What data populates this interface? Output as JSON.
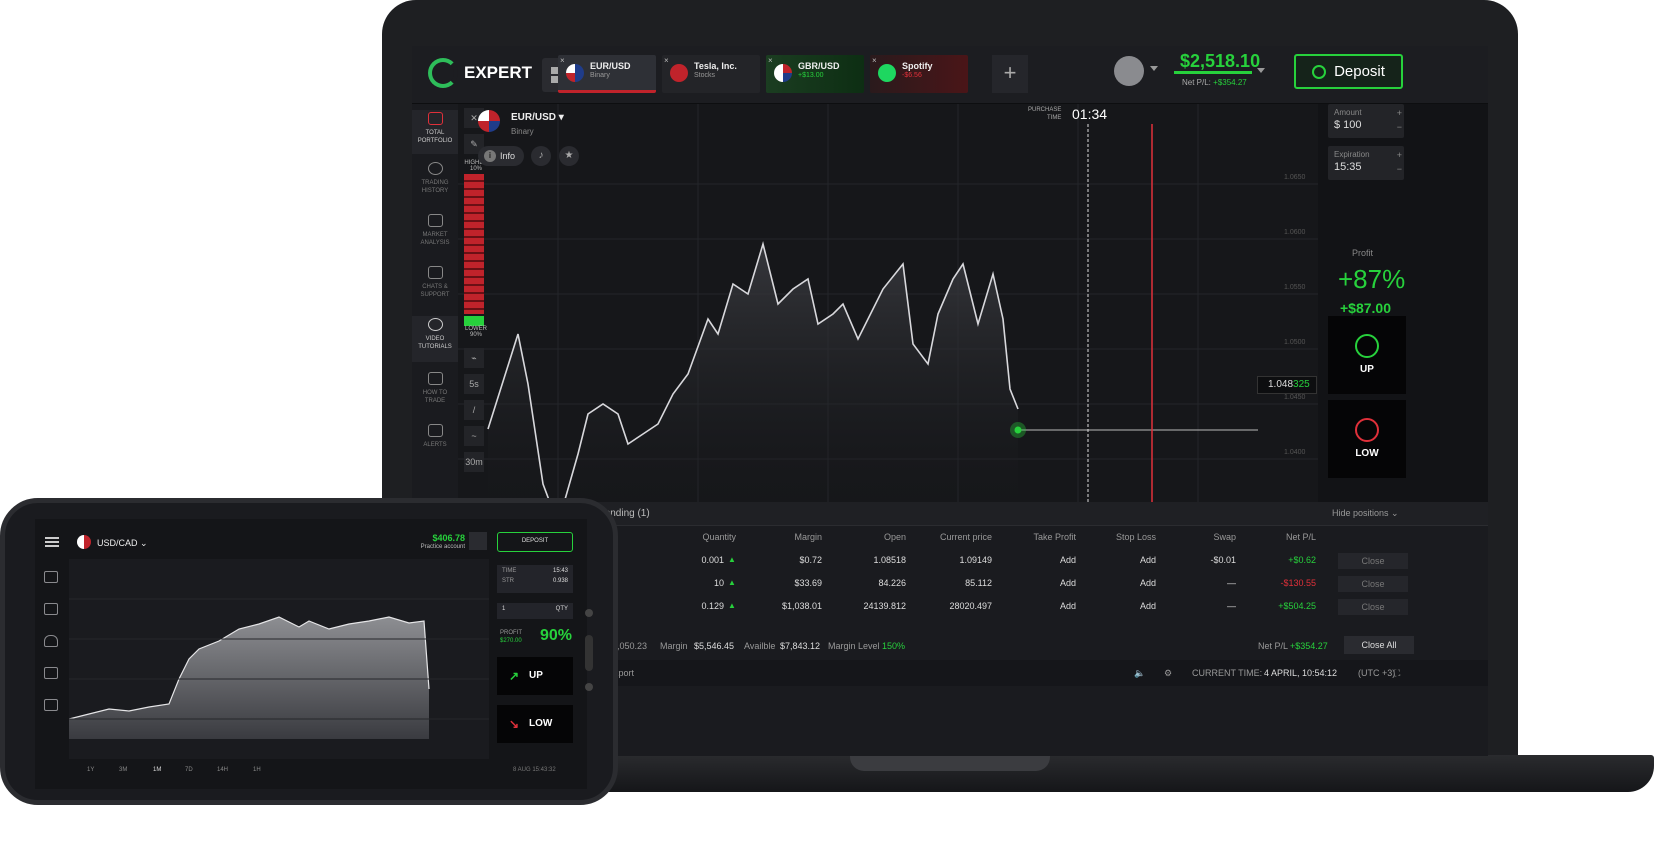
{
  "app": {
    "brand": "EXPERT"
  },
  "tabs": [
    {
      "name": "EUR/USD",
      "sub": "Binary",
      "sub_tone": "neutral"
    },
    {
      "name": "Tesla, Inc.",
      "sub": "Stocks",
      "sub_tone": "neutral"
    },
    {
      "name": "GBR/USD",
      "sub": "+$13.00",
      "sub_tone": "green"
    },
    {
      "name": "Spotify",
      "sub": "-$6.56",
      "sub_tone": "red"
    }
  ],
  "header": {
    "balance": "$2,518.10",
    "net_pl_label": "Net P/L:",
    "net_pl": "+$354.27",
    "deposit_label": "Deposit"
  },
  "sidebar": [
    "TOTAL PORTFOLIO",
    "TRADING HISTORY",
    "MARKET ANALYSIS",
    "CHATS & SUPPORT",
    "VIDEO TUTORIALS",
    "HOW TO TRADE",
    "ALERTS"
  ],
  "tools": {
    "higher": "HIGHER",
    "higher_pct": "10%",
    "lower": "LOWER",
    "lower_pct": "90%",
    "s5": "5s",
    "tf": "30m"
  },
  "chart": {
    "pair": "EUR/USD",
    "type": "Binary",
    "info_label": "Info",
    "purchase_label_1": "PURCHASE",
    "purchase_label_2": "TIME",
    "purchase_time": "01:34",
    "price_main": "1.048",
    "price_tail": "325"
  },
  "trade_panel": {
    "amount_label": "Amount",
    "amount": "$ 100",
    "expiration_label": "Expiration",
    "expiration": "15:35",
    "profit_label": "Profit",
    "profit_pct": "+87%",
    "profit_amt": "+$87.00",
    "up": "UP",
    "low": "LOW"
  },
  "positions": {
    "pending_tab": "Pending (1)",
    "hide_label": "Hide positions",
    "columns": [
      "Quantity",
      "Margin",
      "Open",
      "Current price",
      "Take Profit",
      "Stop Loss",
      "Swap",
      "Net P/L"
    ],
    "rows": [
      {
        "qty": "0.001",
        "margin": "$0.72",
        "open": "1.08518",
        "current": "1.09149",
        "tp": "Add",
        "sl": "Add",
        "swap": "-$0.01",
        "pl": "+$0.62",
        "pl_tone": "green",
        "close": "Close"
      },
      {
        "qty": "10",
        "margin": "$33.69",
        "open": "84.226",
        "current": "85.112",
        "tp": "Add",
        "sl": "Add",
        "swap": "—",
        "pl": "-$130.55",
        "pl_tone": "red",
        "close": "Close"
      },
      {
        "qty": "0.129",
        "margin": "$1,038.01",
        "open": "24139.812",
        "current": "28020.497",
        "tp": "Add",
        "sl": "Add",
        "swap": "—",
        "pl": "+$504.25",
        "pl_tone": "green",
        "close": "Close"
      }
    ],
    "summary": {
      "equity": "3,050.23",
      "margin_label": "Margin",
      "margin": "$5,546.45",
      "avail_label": "Availble",
      "avail": "$7,843.12",
      "level_label": "Margin Level",
      "level": "150%",
      "net_label": "Net P/L",
      "net": "+$354.27",
      "close_all": "Close All"
    },
    "status": {
      "export": "Export",
      "time_label": "CURRENT TIME:",
      "time": "4 APRIL, 10:54:12",
      "tz": "(UTC +3)"
    }
  },
  "phone": {
    "pair": "USD/CAD",
    "balance": "$406.78",
    "account": "Practice account",
    "deposit": "DEPOSIT",
    "time_label": "TIME",
    "time": "15:43",
    "str_label": "STR",
    "str": "0.938",
    "qty": "1",
    "qty_label": "QTY",
    "profit_label": "PROFIT",
    "profit_amt": "$270.00",
    "profit_pct": "90%",
    "up": "UP",
    "low": "LOW",
    "timeframes": [
      "1Y",
      "3M",
      "1M",
      "7D",
      "14H",
      "1H"
    ],
    "date": "8 AUG 15:43:32"
  },
  "colors": {
    "green": "#27d13c",
    "red": "#e0303a",
    "bg": "#121316"
  }
}
